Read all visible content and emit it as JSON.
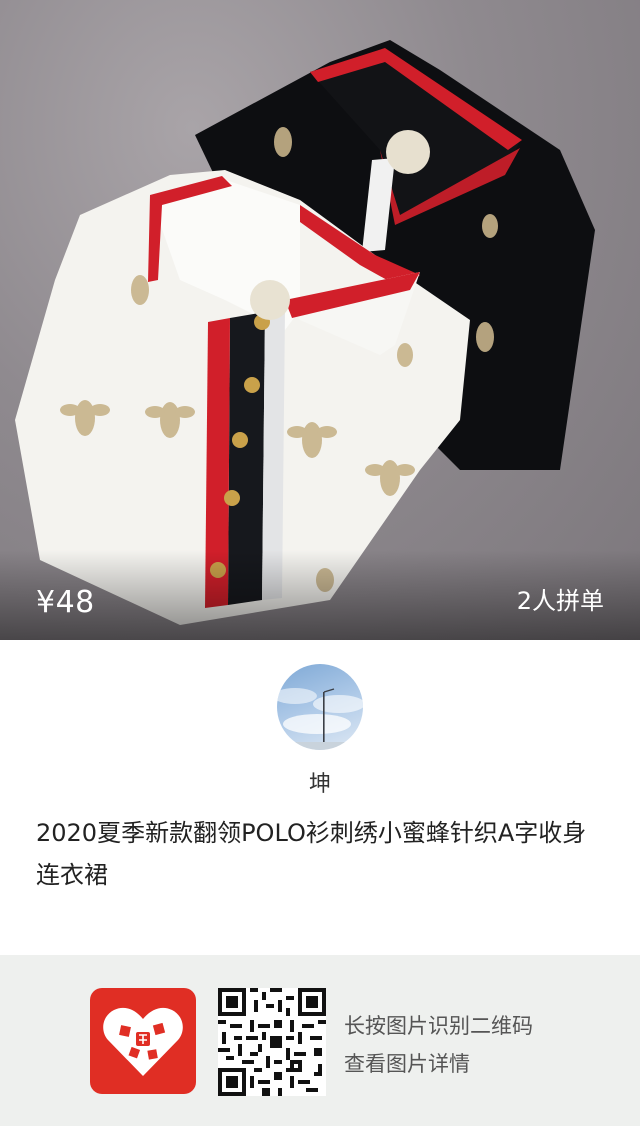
{
  "product": {
    "price": "¥48",
    "group_label": "2人拼单",
    "title": "2020夏季新款翻领POLO衫刺绣小蜜蜂针织A字收身连衣裙"
  },
  "seller": {
    "name": "坤"
  },
  "share": {
    "hint_line1": "长按图片识别二维码",
    "hint_line2": "查看图片详情"
  },
  "colors": {
    "brand": "#e02e24",
    "footer_bg": "#eef0ee"
  }
}
